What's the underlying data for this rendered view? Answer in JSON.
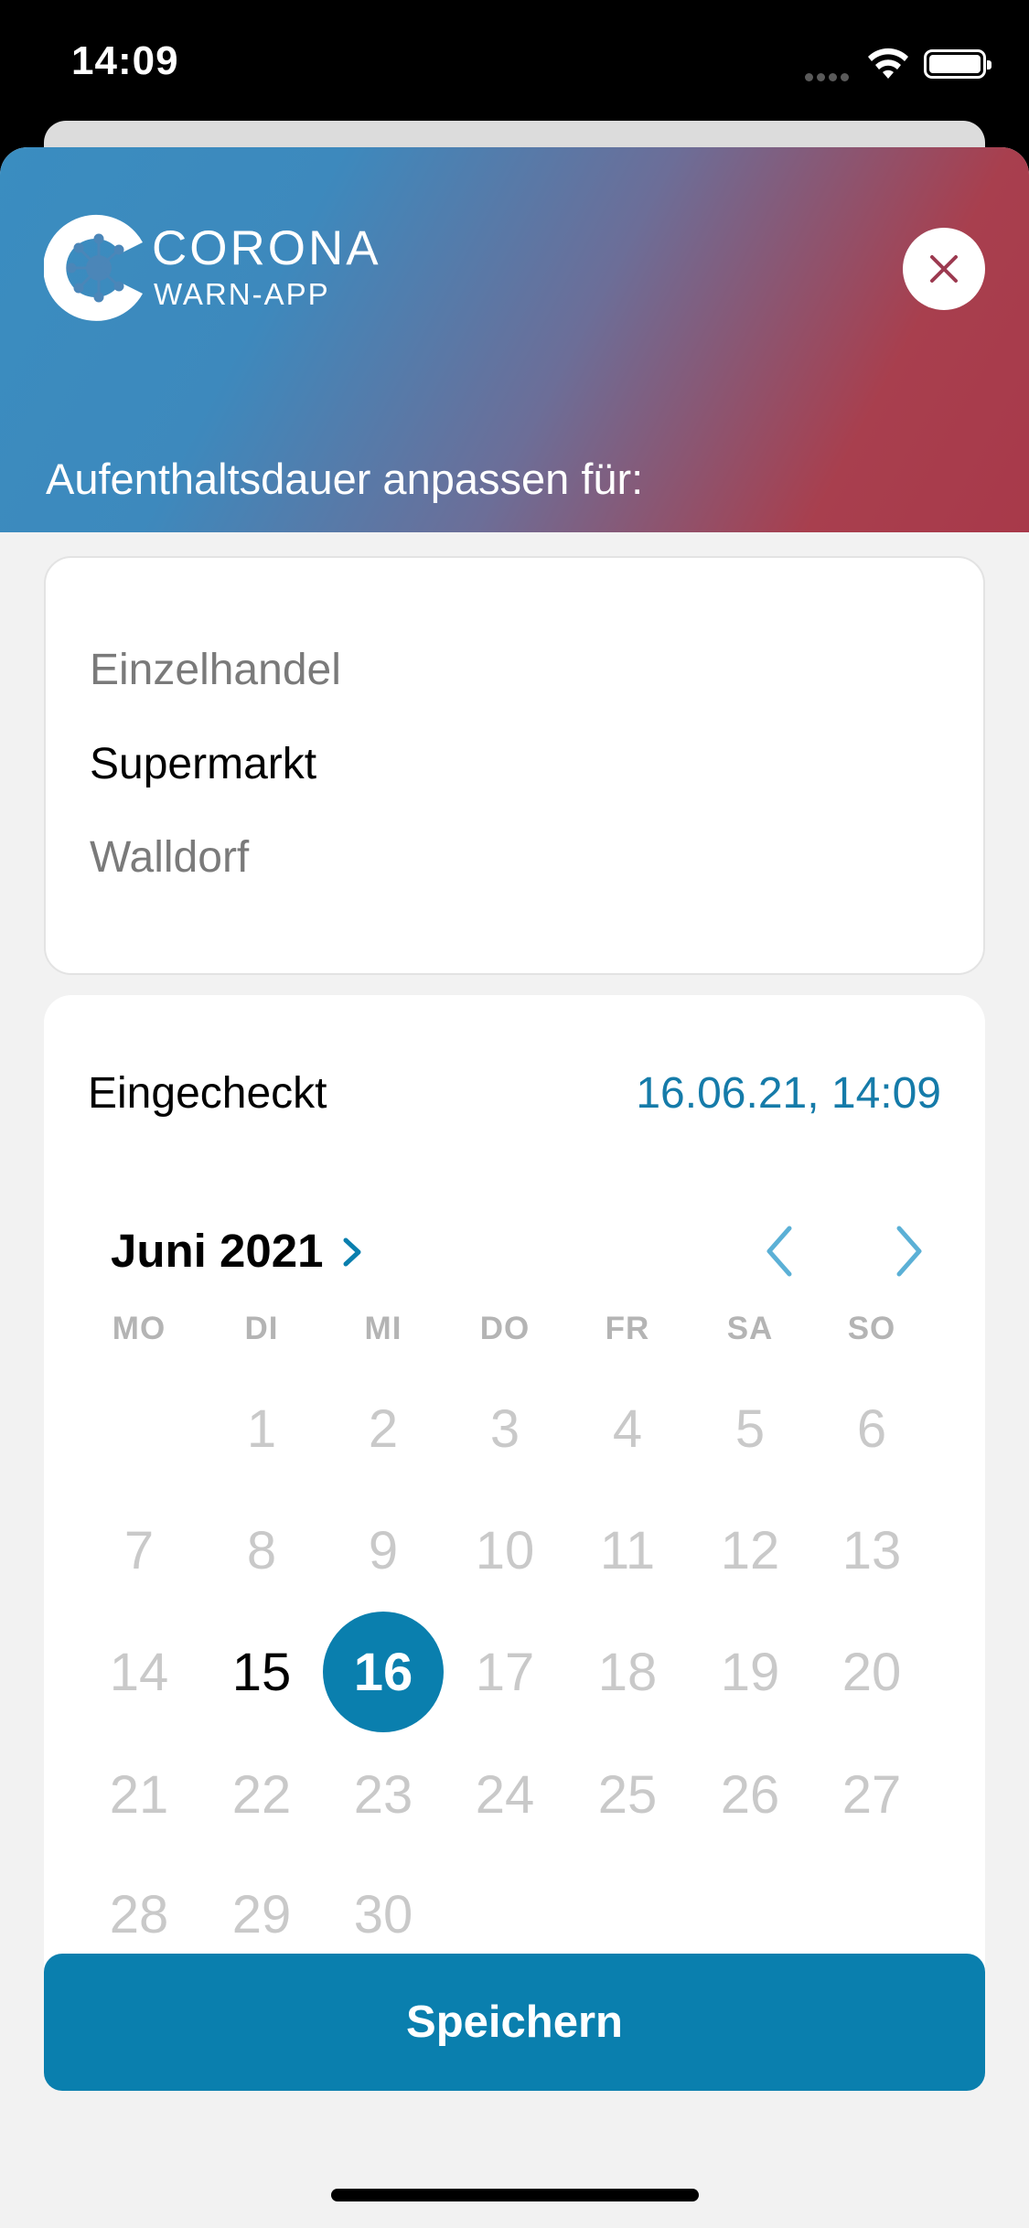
{
  "status_bar": {
    "time": "14:09"
  },
  "header": {
    "logo_title": "CORONA",
    "logo_subtitle": "WARN-APP",
    "title": "Aufenthaltsdauer anpassen für:",
    "gradient_colors": [
      "#3a8dc0",
      "#6c6e98",
      "#a8394a"
    ]
  },
  "location": {
    "type": "Einzelhandel",
    "description": "Supermarkt",
    "address": "Walldorf"
  },
  "checkin": {
    "label": "Eingecheckt",
    "value": "16.06.21, 14:09"
  },
  "calendar": {
    "month_label": "Juni 2021",
    "weekdays": [
      "MO",
      "DI",
      "MI",
      "DO",
      "FR",
      "SA",
      "SO"
    ],
    "selected_day": "16",
    "enabled_days": [
      "15",
      "16"
    ],
    "weeks": [
      [
        "",
        "1",
        "2",
        "3",
        "4",
        "5",
        "6"
      ],
      [
        "7",
        "8",
        "9",
        "10",
        "11",
        "12",
        "13"
      ],
      [
        "14",
        "15",
        "16",
        "17",
        "18",
        "19",
        "20"
      ],
      [
        "21",
        "22",
        "23",
        "24",
        "25",
        "26",
        "27"
      ],
      [
        "28",
        "29",
        "30",
        "",
        "",
        "",
        ""
      ]
    ],
    "accent_color": "#0a7fae"
  },
  "save_button": {
    "label": "Speichern"
  }
}
